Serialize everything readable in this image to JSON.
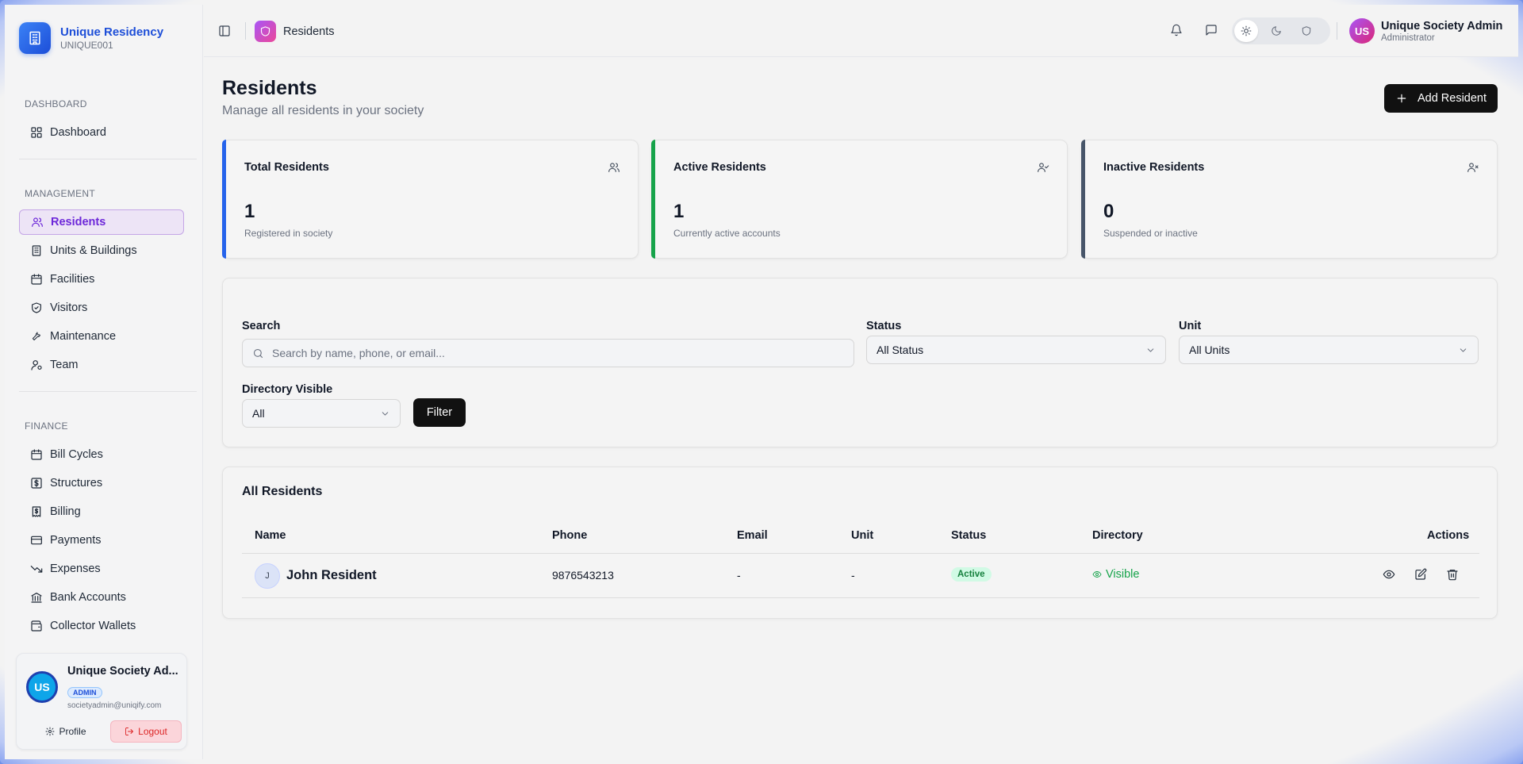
{
  "brand": {
    "name": "Unique Residency",
    "code": "UNIQUE001"
  },
  "sidebar": {
    "sections": [
      {
        "heading": "DASHBOARD",
        "items": [
          {
            "label": "Dashboard",
            "icon": "grid-icon"
          }
        ]
      },
      {
        "heading": "MANAGEMENT",
        "items": [
          {
            "label": "Residents",
            "icon": "users-icon",
            "active": true
          },
          {
            "label": "Units & Buildings",
            "icon": "building-icon"
          },
          {
            "label": "Facilities",
            "icon": "calendar-icon"
          },
          {
            "label": "Visitors",
            "icon": "shield-icon"
          },
          {
            "label": "Maintenance",
            "icon": "wrench-icon"
          },
          {
            "label": "Team",
            "icon": "user-team-icon"
          }
        ]
      },
      {
        "heading": "FINANCE",
        "items": [
          {
            "label": "Bill Cycles",
            "icon": "calendar-icon"
          },
          {
            "label": "Structures",
            "icon": "dollar-icon"
          },
          {
            "label": "Billing",
            "icon": "receipt-icon"
          },
          {
            "label": "Payments",
            "icon": "card-icon"
          },
          {
            "label": "Expenses",
            "icon": "trend-down-icon"
          },
          {
            "label": "Bank Accounts",
            "icon": "bank-icon"
          },
          {
            "label": "Collector Wallets",
            "icon": "wallet-icon"
          }
        ]
      }
    ]
  },
  "user_card": {
    "initials": "US",
    "name": "Unique Society Ad...",
    "badge": "ADMIN",
    "email": "societyadmin@uniqify.com",
    "profile_label": "Profile",
    "logout_label": "Logout"
  },
  "header": {
    "breadcrumb": "Residents",
    "user_initials": "US",
    "user_name": "Unique Society Admin",
    "user_role": "Administrator"
  },
  "page": {
    "title": "Residents",
    "subtitle": "Manage all residents in your society",
    "add_button": "Add Resident"
  },
  "stats": [
    {
      "label": "Total Residents",
      "value": "1",
      "note": "Registered in society",
      "accent": "#2563eb",
      "icon": "users-icon"
    },
    {
      "label": "Active Residents",
      "value": "1",
      "note": "Currently active accounts",
      "accent": "#16a34a",
      "icon": "user-check-icon"
    },
    {
      "label": "Inactive Residents",
      "value": "0",
      "note": "Suspended or inactive",
      "accent": "#475569",
      "icon": "user-x-icon"
    }
  ],
  "filters": {
    "search_label": "Search",
    "search_placeholder": "Search by name, phone, or email...",
    "status_label": "Status",
    "status_value": "All Status",
    "unit_label": "Unit",
    "unit_value": "All Units",
    "directory_label": "Directory Visible",
    "directory_value": "All",
    "filter_button": "Filter"
  },
  "table": {
    "title": "All Residents",
    "columns": [
      "Name",
      "Phone",
      "Email",
      "Unit",
      "Status",
      "Directory",
      "Actions"
    ],
    "rows": [
      {
        "initial": "J",
        "name": "John Resident",
        "phone": "9876543213",
        "email": "-",
        "unit": "-",
        "status": "Active",
        "directory": "Visible"
      }
    ]
  },
  "colors": {
    "accent_purple": "#6d28d9",
    "brand_blue": "#1d4ed8",
    "active_green": "#16a34a"
  }
}
